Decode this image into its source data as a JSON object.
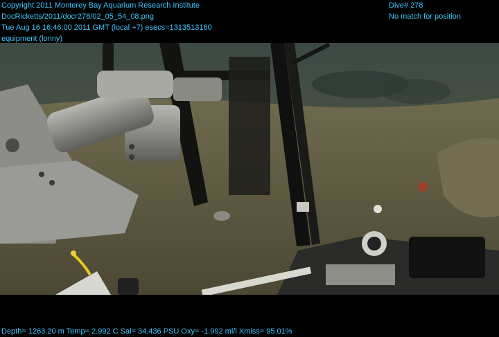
{
  "header": {
    "copyright": "Copyright 2011 Monterey Bay Aquarium Research Institute",
    "file_path": "DocRicketts/2011/docr278/02_05_54_08.png",
    "timestamp": "Tue Aug 16 16:46:00 2011 GMT (local +7)  esecs=1313513160",
    "category": "equipment (lonny)",
    "dive": "Dive# 278",
    "position_status": "No match for position"
  },
  "telemetry": {
    "line": "Depth= 1263.20 m  Temp= 2.992 C  Sal= 34.436 PSU  Oxy= -1.992 ml/l  Xmiss= 95.01%"
  },
  "colors": {
    "overlay_text": "#3ec8ff",
    "background": "#000000",
    "seafloor": "#6d6648"
  },
  "scene": {
    "description_icons": [
      "robotic-arm",
      "sampling-frame",
      "instrument-payload"
    ]
  }
}
